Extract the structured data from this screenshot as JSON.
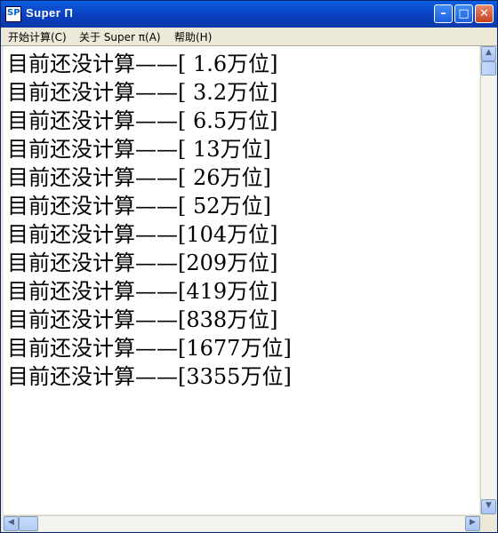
{
  "window": {
    "title": "Super Π",
    "icon_text": "SP",
    "controls": {
      "minimize": "–",
      "maximize": "□",
      "close": "✕"
    }
  },
  "menu": [
    {
      "label": "开始计算(C)"
    },
    {
      "label": "关于 Super π(A)"
    },
    {
      "label": "帮助(H)"
    }
  ],
  "output_lines": [
    "目前还没计算——[ 1.6万位]",
    "目前还没计算——[ 3.2万位]",
    "目前还没计算——[ 6.5万位]",
    "目前还没计算——[ 13万位]",
    "目前还没计算——[ 26万位]",
    "目前还没计算——[ 52万位]",
    "目前还没计算——[104万位]",
    "目前还没计算——[209万位]",
    "目前还没计算——[419万位]",
    "目前还没计算——[838万位]",
    "目前还没计算——[1677万位]",
    "目前还没计算——[3355万位]"
  ],
  "scrollbars": {
    "up_arrow": "▲",
    "down_arrow": "▼",
    "left_arrow": "◀",
    "right_arrow": "▶"
  }
}
